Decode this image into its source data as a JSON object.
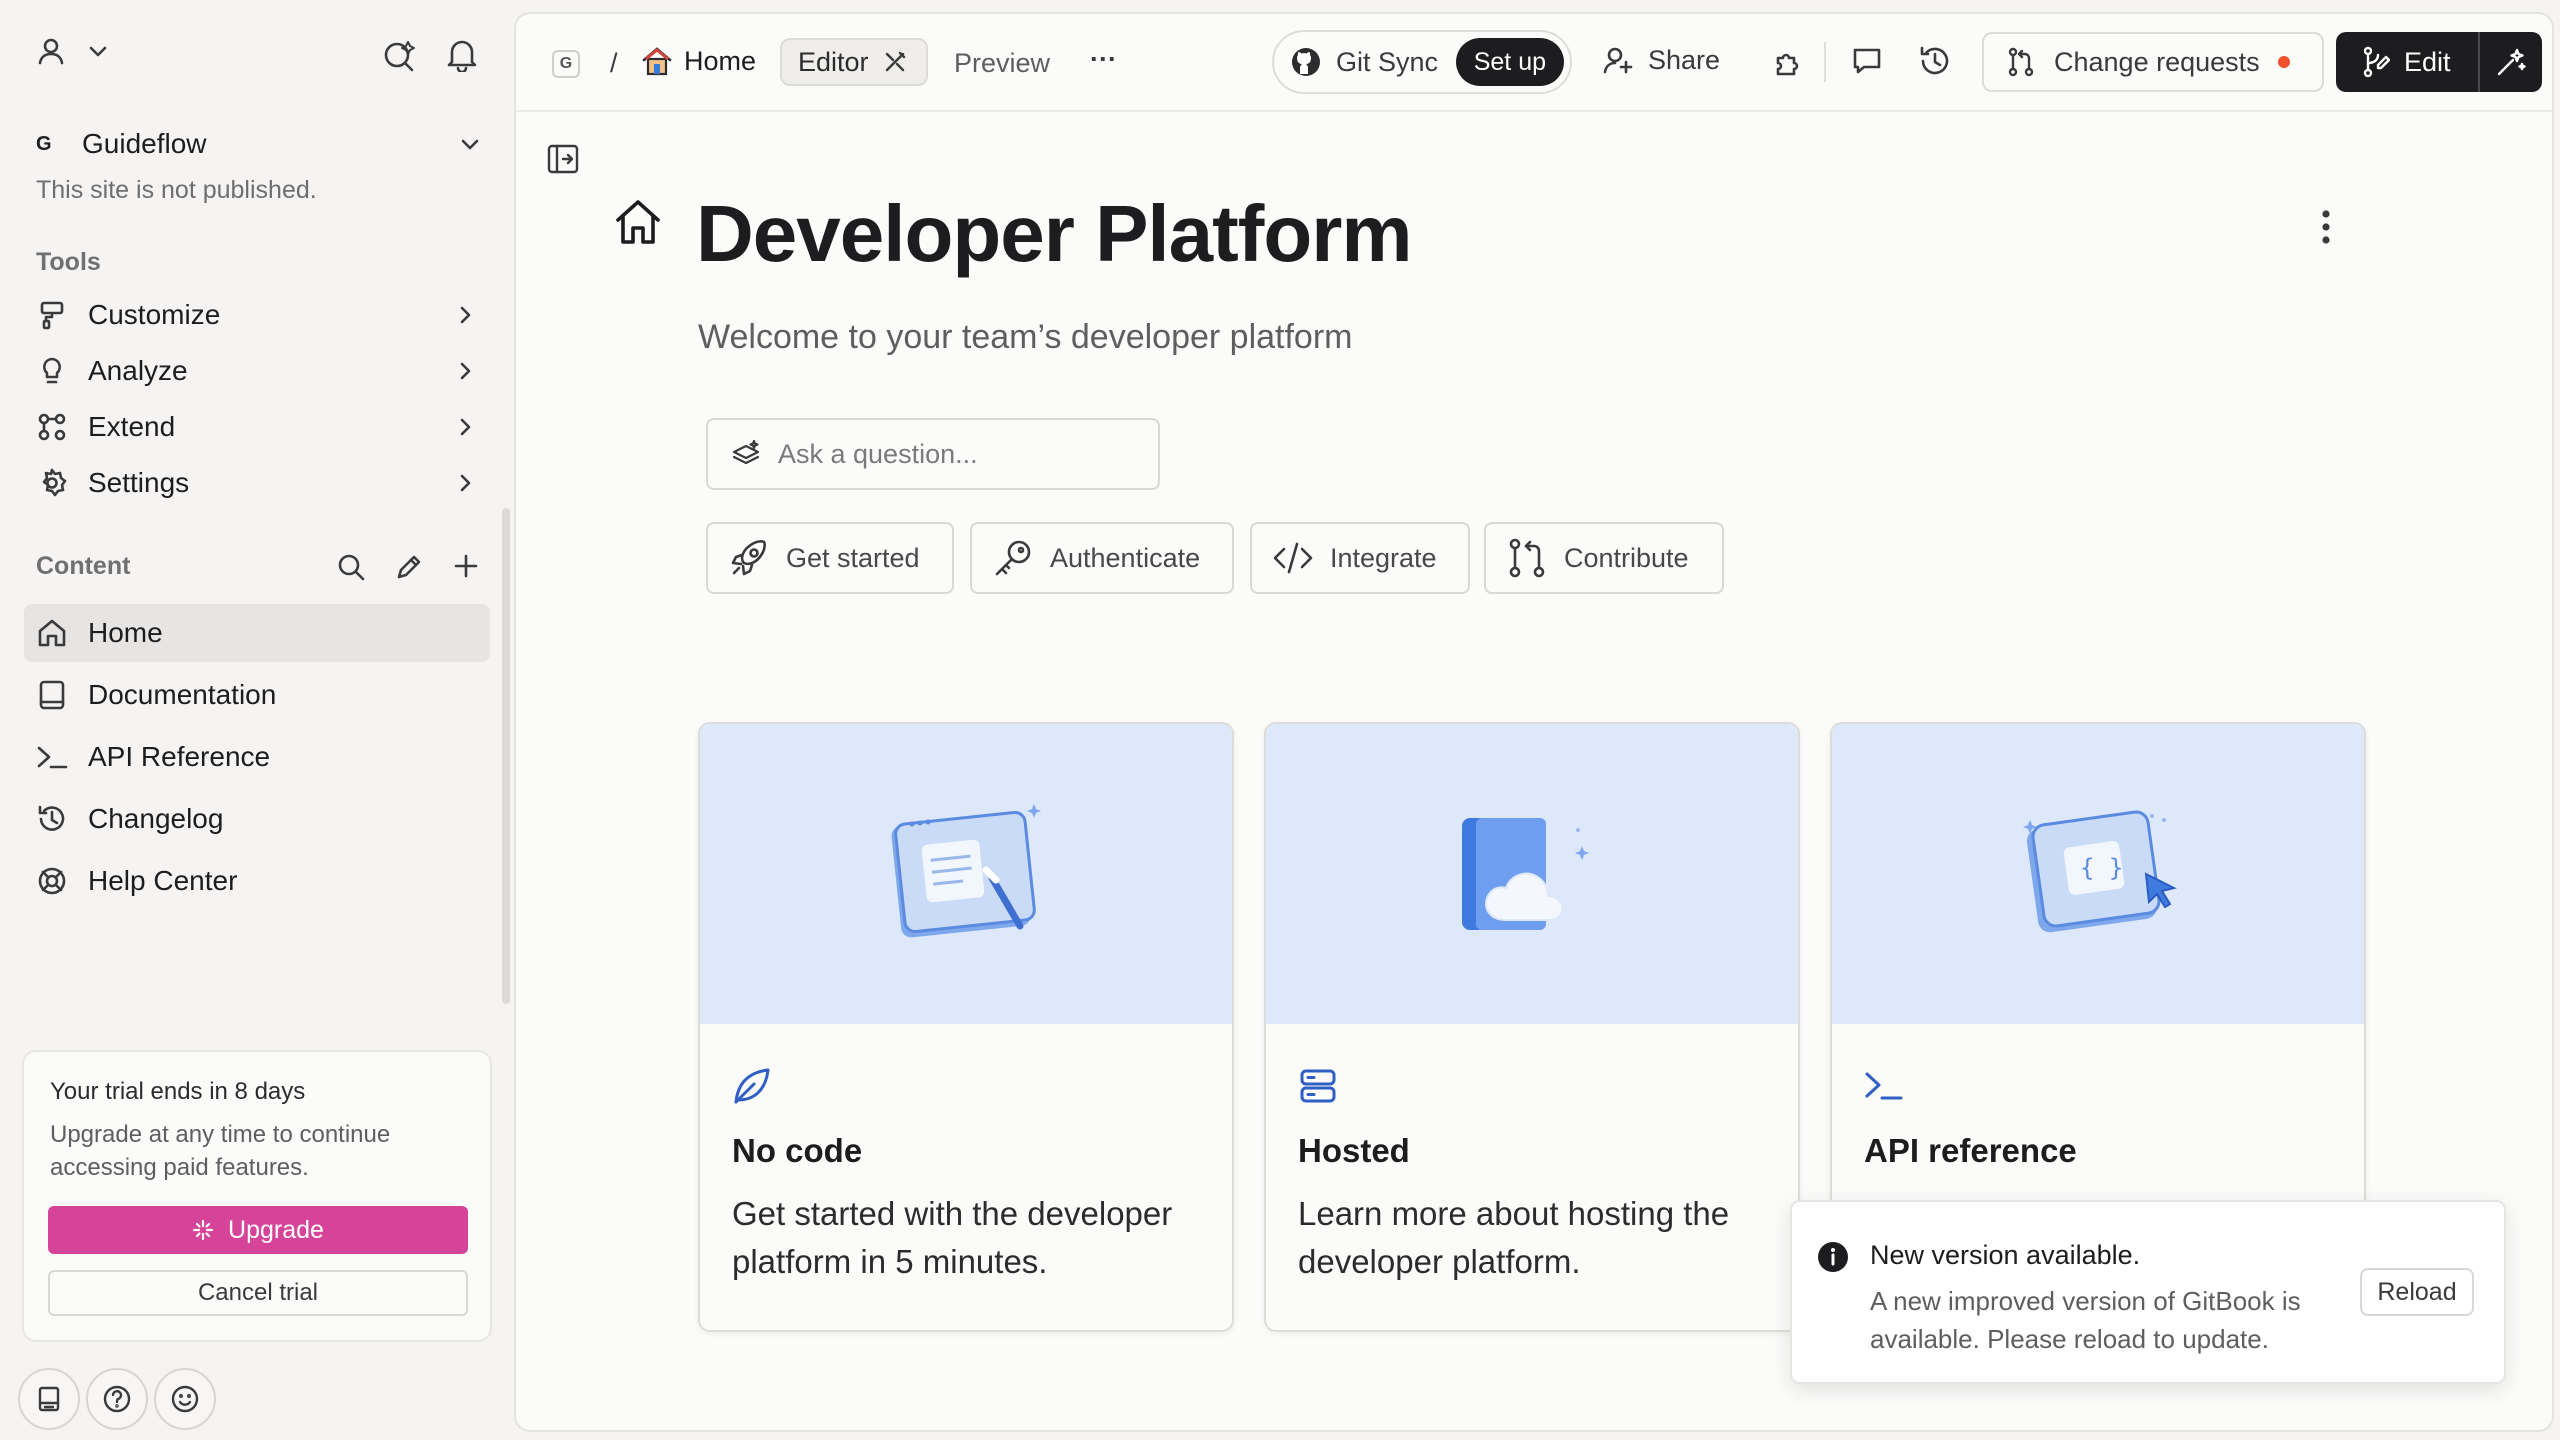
{
  "colors": {
    "accent_pink": "#d6449a",
    "toast_dot": "#f0502a",
    "card_hero": "#dde9fb",
    "icon_blue": "#2f5fc4"
  },
  "sidebar": {
    "space_initial": "G",
    "space_name": "Guideflow",
    "site_status": "This site is not published.",
    "tools_label": "Tools",
    "tools": [
      {
        "label": "Customize",
        "icon": "paint-roller-icon"
      },
      {
        "label": "Analyze",
        "icon": "lightbulb-icon"
      },
      {
        "label": "Extend",
        "icon": "puzzle-nodes-icon"
      },
      {
        "label": "Settings",
        "icon": "gear-icon"
      }
    ],
    "content_label": "Content",
    "pages": [
      {
        "label": "Home",
        "icon": "house-icon",
        "active": true
      },
      {
        "label": "Documentation",
        "icon": "book-icon"
      },
      {
        "label": "API Reference",
        "icon": "terminal-icon"
      },
      {
        "label": "Changelog",
        "icon": "history-icon"
      },
      {
        "label": "Help Center",
        "icon": "lifebuoy-icon"
      }
    ],
    "trial": {
      "title": "Your trial ends in 8 days",
      "body": "Upgrade at any time to continue accessing paid features.",
      "upgrade_label": "Upgrade",
      "cancel_label": "Cancel trial"
    }
  },
  "topbar": {
    "logo_initial": "G",
    "breadcrumb_sep": "/",
    "breadcrumb_page": "Home",
    "tab_editor": "Editor",
    "tab_preview": "Preview",
    "more": "···",
    "git_sync_label": "Git Sync",
    "git_sync_action": "Set up",
    "share_label": "Share",
    "change_requests_label": "Change requests",
    "edit_label": "Edit"
  },
  "page": {
    "title": "Developer Platform",
    "subtitle": "Welcome to your team’s developer platform",
    "ask_placeholder": "Ask a question...",
    "quick_links": [
      {
        "label": "Get started",
        "icon": "rocket-icon"
      },
      {
        "label": "Authenticate",
        "icon": "key-icon"
      },
      {
        "label": "Integrate",
        "icon": "code-icon"
      },
      {
        "label": "Contribute",
        "icon": "git-pull-request-icon"
      }
    ],
    "cards": [
      {
        "title": "No code",
        "desc": "Get started with the developer platform in 5 minutes.",
        "icon": "leaf-icon"
      },
      {
        "title": "Hosted",
        "desc": "Learn more about hosting the developer platform.",
        "icon": "server-icon"
      },
      {
        "title": "API reference",
        "desc": "",
        "icon": "terminal-icon"
      }
    ]
  },
  "toast": {
    "title": "New version available.",
    "body": "A new improved version of GitBook is available. Please reload to update.",
    "reload_label": "Reload"
  }
}
